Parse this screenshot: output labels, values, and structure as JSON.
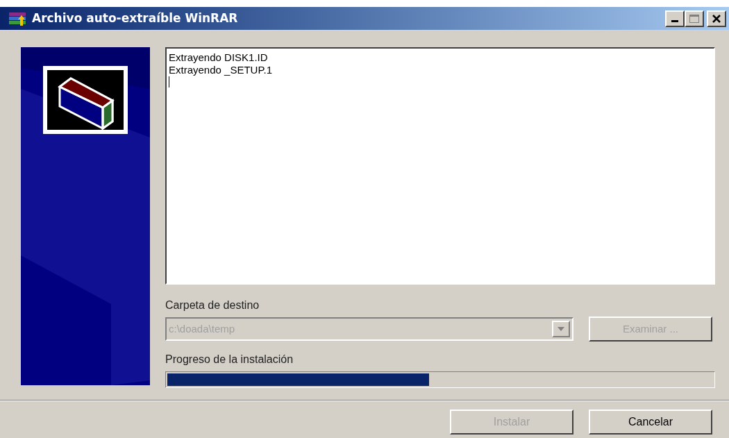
{
  "window": {
    "title": "Archivo auto-extraíble WinRAR"
  },
  "log": {
    "lines": [
      "Extrayendo DISK1.ID",
      "Extrayendo _SETUP.1"
    ]
  },
  "destination": {
    "label": "Carpeta de destino",
    "value": "c:\\doada\\temp",
    "disabled": true
  },
  "browse_button": {
    "label": "Examinar ...",
    "disabled": true
  },
  "progress": {
    "label": "Progreso de la instalación",
    "level": 0.48
  },
  "buttons": [
    {
      "label": "Instalar",
      "disabled": true
    },
    {
      "label": "Cancelar",
      "disabled": false
    }
  ]
}
